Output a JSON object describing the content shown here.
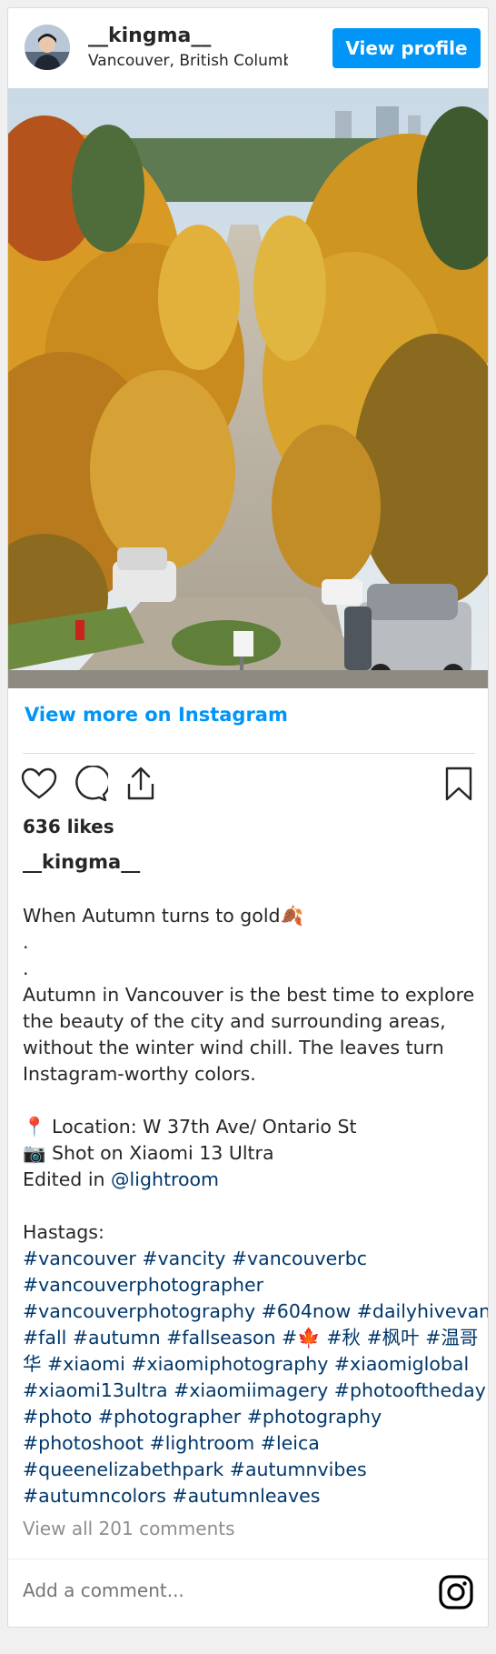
{
  "header": {
    "username": "__kingma__",
    "location": "Vancouver, British Columbia",
    "view_profile_label": "View profile"
  },
  "post": {
    "view_more_label": "View more on Instagram",
    "likes": "636 likes",
    "caption_user": "__kingma__",
    "caption_lines": [
      {
        "text": "When Autumn turns to gold🍂"
      },
      {
        "text": "."
      },
      {
        "text": "."
      },
      {
        "text": "Autumn in Vancouver is the best time to explore"
      },
      {
        "text": "the beauty of the city and surrounding areas,"
      },
      {
        "text": "without the winter wind chill. The leaves turn"
      },
      {
        "text": "Instagram-worthy colors."
      },
      {
        "text": ""
      },
      {
        "text": "📍 Location: W 37th Ave/ Ontario St"
      },
      {
        "text": "📷 Shot on Xiaomi 13 Ultra"
      },
      {
        "text_before": "Edited in ",
        "link": "@lightroom"
      },
      {
        "text": ""
      },
      {
        "text": "Hastags:"
      },
      {
        "link": "#vancouver #vancity #vancouverbc"
      },
      {
        "link": "#vancouverphotographer"
      },
      {
        "link": "#vancouverphotography #604now #dailyhivevan"
      },
      {
        "link": "#fall #autumn #fallseason #🍁 #秋 #枫叶 #温哥"
      },
      {
        "link": "华 #xiaomi #xiaomiphotography #xiaomiglobal"
      },
      {
        "link": "#xiaomi13ultra #xiaomiimagery #photooftheday"
      },
      {
        "link": "#photo #photographer #photography"
      },
      {
        "link": "#photoshoot #lightroom #leica"
      },
      {
        "link": "#queenelizabethpark #autumnvibes"
      },
      {
        "link": "#autumncolors #autumnleaves"
      }
    ],
    "view_all_comments": "View all 201 comments",
    "add_comment_placeholder": "Add a comment..."
  },
  "icons": [
    "heart-icon",
    "comment-icon",
    "share-icon",
    "bookmark-icon",
    "instagram-icon"
  ],
  "colors": {
    "accent": "#0095f6",
    "link": "#00376b",
    "muted": "#8e8e8e"
  }
}
